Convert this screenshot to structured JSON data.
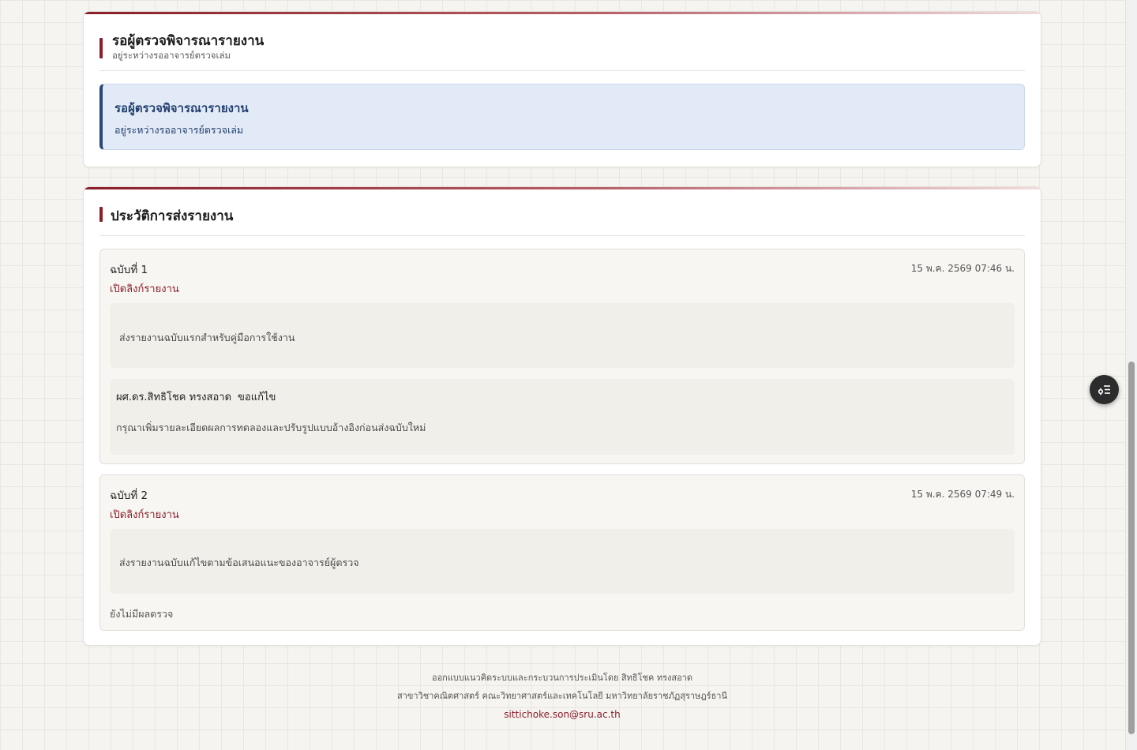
{
  "status_card": {
    "title": "รอผู้ตรวจพิจารณารายงาน",
    "subtitle": "อยู่ระหว่างรออาจารย์ตรวจเล่ม",
    "status_box": {
      "title": "รอผู้ตรวจพิจารณารายงาน",
      "description": "อยู่ระหว่างรออาจารย์ตรวจเล่ม"
    }
  },
  "history_card": {
    "title": "ประวัติการส่งรายงาน",
    "versions": [
      {
        "label": "ฉบับที่ 1",
        "date": "15 พ.ค. 2569 07:46 น.",
        "link_label": "เปิดลิงก์รายงาน",
        "note": "ส่งรายงานฉบับแรกสำหรับคู่มือการใช้งาน",
        "review": {
          "reviewer": "ผศ.ดร.สิทธิโชค ทรงสอาด",
          "verdict": "ขอแก้ไข",
          "comment": "กรุณาเพิ่มรายละเอียดผลการทดลองและปรับรูปแบบอ้างอิงก่อนส่งฉบับใหม่"
        }
      },
      {
        "label": "ฉบับที่ 2",
        "date": "15 พ.ค. 2569 07:49 น.",
        "link_label": "เปิดลิงก์รายงาน",
        "note": "ส่งรายงานฉบับแก้ไขตามข้อเสนอแนะของอาจารย์ผู้ตรวจ",
        "no_review": "ยังไม่มีผลตรวจ"
      }
    ]
  },
  "footer": {
    "line1": "ออกแบบแนวคิดระบบและกระบวนการประเมินโดย สิทธิโชค ทรงสอาด",
    "line2": "สาขาวิชาคณิตศาสตร์ คณะวิทยาศาสตร์และเทคโนโลยี มหาวิทยาลัยราชภัฏสุราษฎร์ธานี",
    "email": "sittichoke.son@sru.ac.th"
  },
  "floating_button": {
    "icon": "list-settings-icon"
  },
  "theme": {
    "accent": "#8b1e2b",
    "status_blue": "#22406e",
    "status_bg": "#e3eaf7"
  }
}
